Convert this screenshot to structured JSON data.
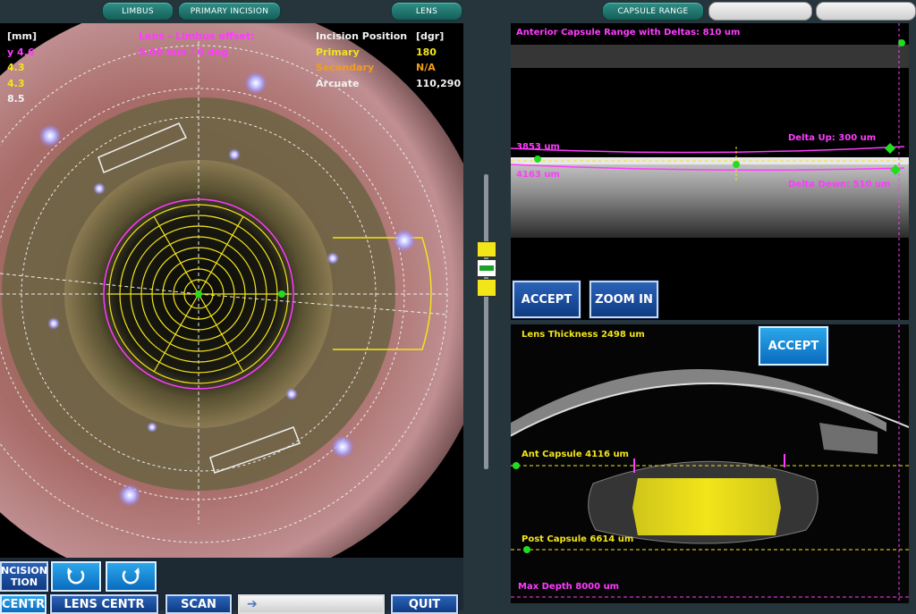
{
  "top_tabs": {
    "limbus": "LIMBUS",
    "primary_incision": "PRIMARY INCISION",
    "lens": "LENS",
    "capsule_range": "CAPSULE RANGE"
  },
  "left_overlay": {
    "mm_header": "[mm]",
    "mm_values": [
      "y 4.6",
      "4.3",
      "4.3",
      "8.5"
    ],
    "offset_title": "Lens - Limbus offset:",
    "offset_value": "0.00 mm / 0 deg",
    "incision_header": "Incision Position",
    "dgr_header": "[dgr]",
    "rows": [
      {
        "label": "Primary",
        "value": "180"
      },
      {
        "label": "Secondary",
        "value": "N/A"
      },
      {
        "label": "Arcuate",
        "value": "110,290"
      }
    ]
  },
  "bottom_buttons": {
    "incision_line1": "NCISION",
    "incision_line2": "TION",
    "centr": "CENTR",
    "lens_centr": "LENS CENTR",
    "scan": "SCAN",
    "quit": "QUIT"
  },
  "capsule_panel": {
    "title": "Anterior Capsule Range with Deltas: 810 um",
    "depth_upper": "3853 um",
    "depth_lower": "4163 um",
    "delta_up": "Delta Up: 300 um",
    "delta_down": "Delta Down: 510 um",
    "accept": "ACCEPT",
    "zoom_in": "ZOOM IN"
  },
  "lens_panel": {
    "thickness": "Lens Thickness 2498 um",
    "accept": "ACCEPT",
    "ant_capsule": "Ant Capsule 4116 um",
    "post_capsule": "Post Capsule 6614 um",
    "max_depth": "Max Depth 8000 um"
  },
  "colors": {
    "magenta": "#ff3bff",
    "yellow": "#f2e51a",
    "green": "#22dd22",
    "accent_teal": "#1f7a72",
    "button_blue": "#1c4f9e"
  }
}
